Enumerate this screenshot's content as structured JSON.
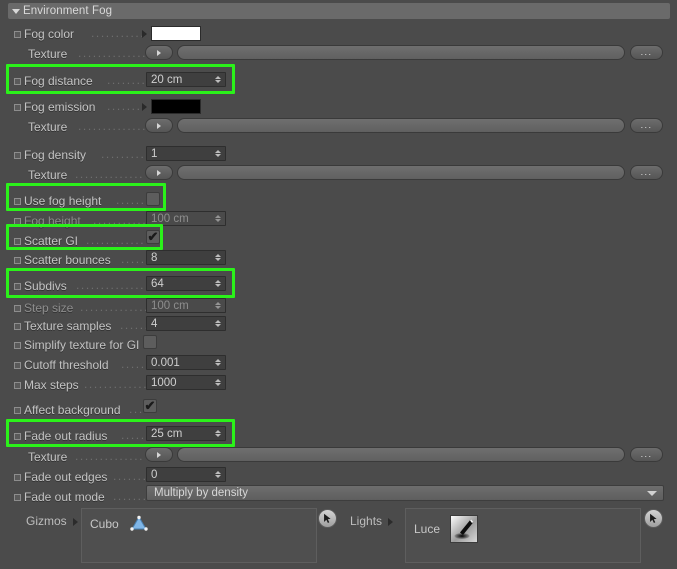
{
  "panel": {
    "title": "Environment Fog",
    "collapse_icon": "chevron-down-icon"
  },
  "rows": [
    {
      "id": "fog-color",
      "label": "Fog color",
      "type": "color",
      "value": "#ffffff"
    },
    {
      "id": "fog-color-texture",
      "label": "Texture",
      "type": "texture",
      "value": "",
      "more_label": "..."
    },
    {
      "id": "fog-distance",
      "label": "Fog distance",
      "type": "number",
      "value": "20 cm",
      "highlight": true
    },
    {
      "id": "fog-emission",
      "label": "Fog emission",
      "type": "color",
      "value": "#000000"
    },
    {
      "id": "fog-emission-texture",
      "label": "Texture",
      "type": "texture",
      "value": "",
      "more_label": "..."
    },
    {
      "id": "fog-density",
      "label": "Fog density",
      "type": "number",
      "value": "1"
    },
    {
      "id": "fog-density-texture",
      "label": "Texture",
      "type": "texture",
      "value": "",
      "more_label": "..."
    },
    {
      "id": "use-fog-height",
      "label": "Use fog height",
      "type": "checkbox",
      "value": false,
      "highlight": true
    },
    {
      "id": "fog-height",
      "label": "Fog height",
      "type": "number",
      "value": "100 cm",
      "disabled": true
    },
    {
      "id": "scatter-gi",
      "label": "Scatter GI",
      "type": "checkbox",
      "value": true,
      "highlight": true
    },
    {
      "id": "scatter-bounces",
      "label": "Scatter bounces",
      "type": "number",
      "value": "8"
    },
    {
      "id": "subdivs",
      "label": "Subdivs",
      "type": "number",
      "value": "64",
      "highlight": true
    },
    {
      "id": "step-size",
      "label": "Step size",
      "type": "number",
      "value": "100 cm",
      "disabled": true
    },
    {
      "id": "texture-samples",
      "label": "Texture samples",
      "type": "number",
      "value": "4"
    },
    {
      "id": "simplify-texture-gi",
      "label": "Simplify texture for GI",
      "type": "checkbox",
      "value": false
    },
    {
      "id": "cutoff-threshold",
      "label": "Cutoff threshold",
      "type": "number",
      "value": "0.001"
    },
    {
      "id": "max-steps",
      "label": "Max steps",
      "type": "number",
      "value": "1000"
    },
    {
      "id": "affect-background",
      "label": "Affect background",
      "type": "checkbox",
      "value": true
    },
    {
      "id": "fade-out-radius",
      "label": "Fade out radius",
      "type": "number",
      "value": "25 cm",
      "highlight": true
    },
    {
      "id": "fade-out-texture",
      "label": "Texture",
      "type": "texture",
      "value": "",
      "more_label": "..."
    },
    {
      "id": "fade-out-edges",
      "label": "Fade out edges",
      "type": "number",
      "value": "0"
    },
    {
      "id": "fade-out-mode",
      "label": "Fade out mode",
      "type": "dropdown",
      "value": "Multiply by density"
    }
  ],
  "labels": {
    "fog_color": "Fog color",
    "texture": "Texture",
    "fog_distance": "Fog distance",
    "fog_emission": "Fog emission",
    "fog_density": "Fog density",
    "use_fog_height": "Use fog height",
    "fog_height": "Fog height",
    "scatter_gi": "Scatter GI",
    "scatter_bounces": "Scatter bounces",
    "subdivs": "Subdivs",
    "step_size": "Step size",
    "texture_samples": "Texture samples",
    "simplify_texture_for_gi": "Simplify texture for GI",
    "cutoff_threshold": "Cutoff threshold",
    "max_steps": "Max steps",
    "affect_background": "Affect background",
    "fade_out_radius": "Fade out radius",
    "fade_out_edges": "Fade out edges",
    "fade_out_mode": "Fade out mode"
  },
  "values": {
    "fog_distance": "20 cm",
    "fog_density": "1",
    "fog_height": "100 cm",
    "scatter_bounces": "8",
    "subdivs": "64",
    "step_size": "100 cm",
    "texture_samples": "4",
    "cutoff_threshold": "0.001",
    "max_steps": "1000",
    "fade_out_radius": "25 cm",
    "fade_out_edges": "0",
    "fade_out_mode": "Multiply by density",
    "fog_color_swatch": "#ffffff",
    "fog_emission_swatch": "#000000"
  },
  "dot_leader": "...........................",
  "more_button_label": "...",
  "gizmos": {
    "label": "Gizmos",
    "items": [
      {
        "name": "Cubo",
        "icon": "cone-gizmo-icon"
      }
    ]
  },
  "lights": {
    "label": "Lights",
    "items": [
      {
        "name": "Luce",
        "icon": "spotlight-icon"
      }
    ]
  },
  "colors": {
    "panel_bg": "#4b4b4b",
    "titlebar_bg": "#6a6a6a",
    "field_bg": "#3f3f3f",
    "text": "#c3c3c3",
    "highlight": "#2bf21a",
    "gizmo_blue": "#6aa8e0"
  }
}
